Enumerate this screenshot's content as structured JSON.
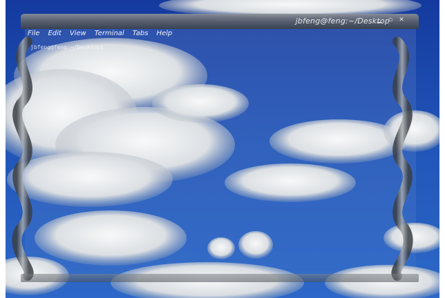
{
  "window": {
    "title": "jbfeng@feng:~/Desktop",
    "title_buttons": [
      "minimize-icon",
      "maximize-icon",
      "close-icon"
    ]
  },
  "menu": {
    "items": [
      "File",
      "Edit",
      "View",
      "Terminal",
      "Tabs",
      "Help"
    ]
  },
  "terminal": {
    "prompt": "jbfeng@feng:~/Desktop$"
  },
  "colors": {
    "sky_top": "#1a3fa6",
    "sky_bottom": "#2c63c7",
    "cloud": "#e9ecef",
    "titlebar": "#5a5f66"
  }
}
